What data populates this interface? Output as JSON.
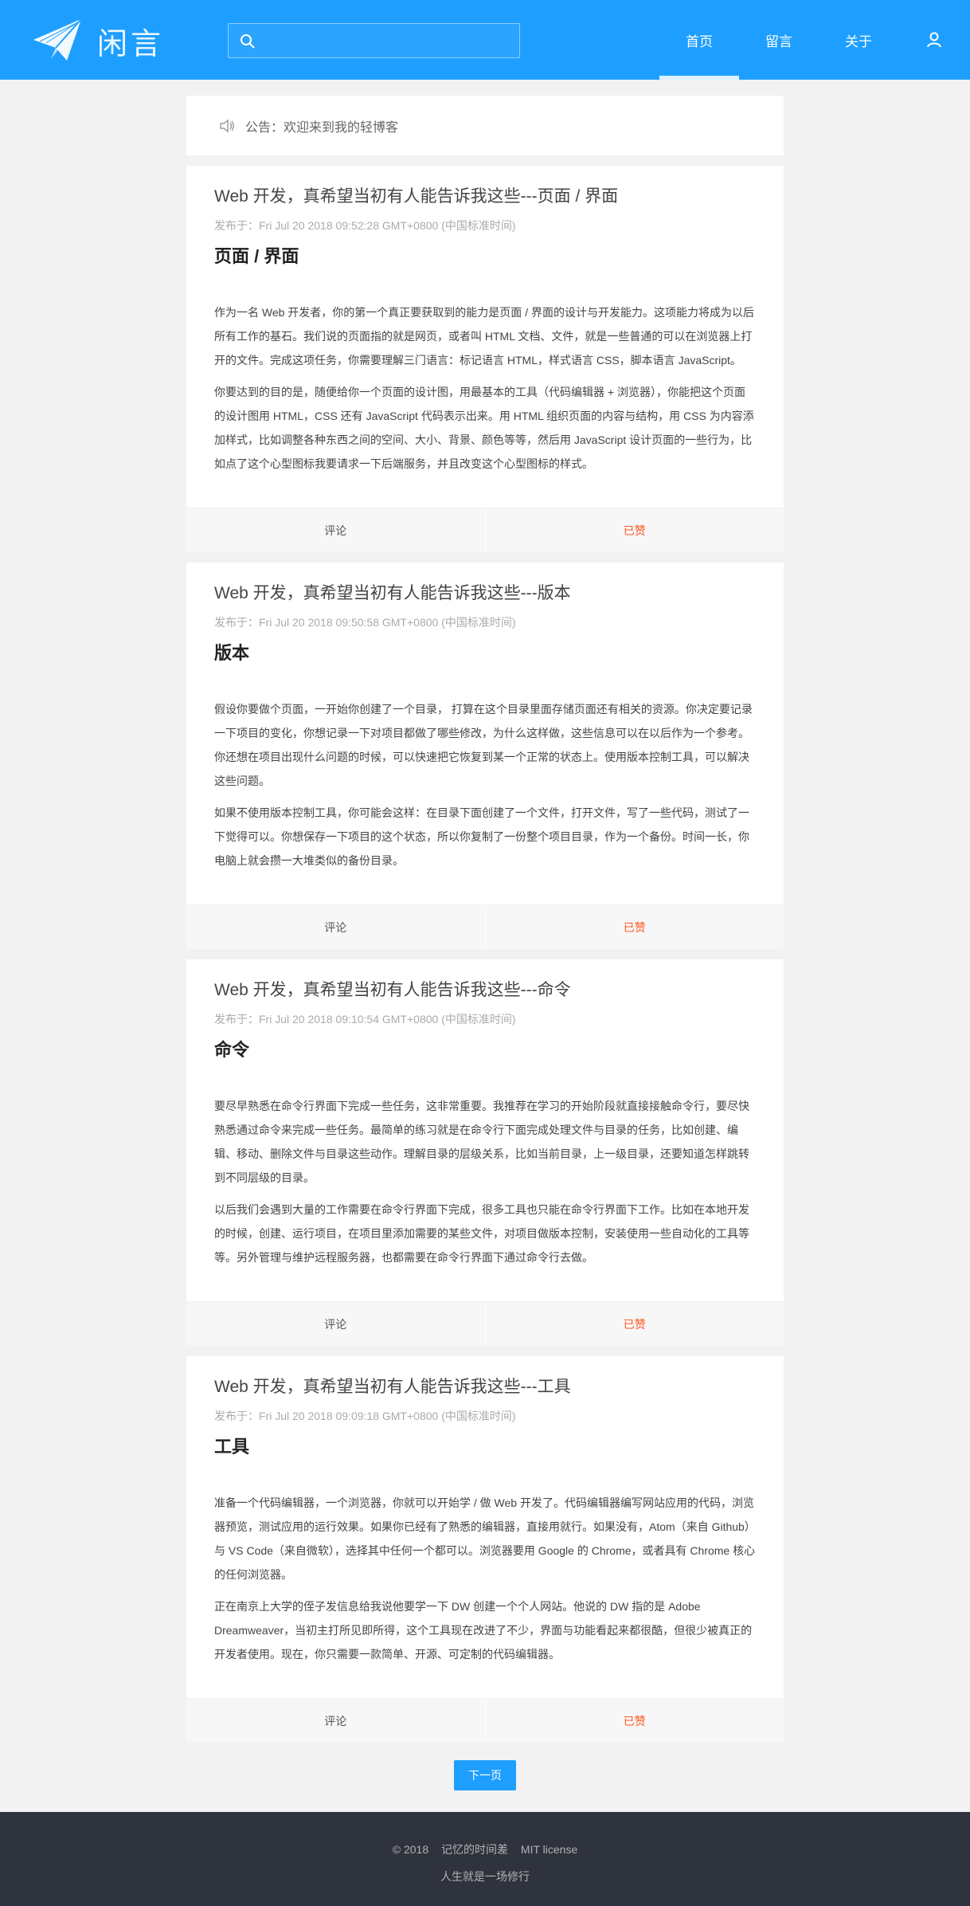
{
  "header": {
    "logo_text": "闲言",
    "search": {
      "placeholder": "",
      "value": ""
    },
    "nav": [
      {
        "label": "首页",
        "active": true
      },
      {
        "label": "留言",
        "active": false
      },
      {
        "label": "关于",
        "active": false
      }
    ]
  },
  "notice": {
    "text": "公告：欢迎来到我的轻博客"
  },
  "posts": [
    {
      "title": "Web 开发，真希望当初有人能告诉我这些---页面 / 界面",
      "meta": "发布于：Fri Jul 20 2018 09:52:28 GMT+0800 (中国标准时间)",
      "heading": "页面 / 界面",
      "paragraphs": [
        "作为一名 Web 开发者，你的第一个真正要获取到的能力是页面 / 界面的设计与开发能力。这项能力将成为以后所有工作的基石。我们说的页面指的就是网页，或者叫 HTML 文档、文件，就是一些普通的可以在浏览器上打开的文件。完成这项任务，你需要理解三门语言：标记语言 HTML，样式语言 CSS，脚本语言 JavaScript。",
        "你要达到的目的是，随便给你一个页面的设计图，用最基本的工具（代码编辑器 + 浏览器），你能把这个页面的设计图用 HTML，CSS 还有 JavaScript 代码表示出来。用 HTML 组织页面的内容与结构，用 CSS 为内容添加样式，比如调整各种东西之间的空间、大小、背景、颜色等等，然后用 JavaScript 设计页面的一些行为，比如点了这个心型图标我要请求一下后端服务，并且改变这个心型图标的样式。"
      ],
      "comment_label": "评论",
      "like_label": "已赞"
    },
    {
      "title": "Web 开发，真希望当初有人能告诉我这些---版本",
      "meta": "发布于：Fri Jul 20 2018 09:50:58 GMT+0800 (中国标准时间)",
      "heading": "版本",
      "paragraphs": [
        "假设你要做个页面，一开始你创建了一个目录， 打算在这个目录里面存储页面还有相关的资源。你决定要记录一下项目的变化，你想记录一下对项目都做了哪些修改，为什么这样做，这些信息可以在以后作为一个参考。你还想在项目出现什么问题的时候，可以快速把它恢复到某一个正常的状态上。使用版本控制工具，可以解决这些问题。",
        "如果不使用版本控制工具，你可能会这样：在目录下面创建了一个文件，打开文件，写了一些代码，测试了一下觉得可以。你想保存一下项目的这个状态，所以你复制了一份整个项目目录，作为一个备份。时间一长，你电脑上就会攒一大堆类似的备份目录。"
      ],
      "comment_label": "评论",
      "like_label": "已赞"
    },
    {
      "title": "Web 开发，真希望当初有人能告诉我这些---命令",
      "meta": "发布于：Fri Jul 20 2018 09:10:54 GMT+0800 (中国标准时间)",
      "heading": "命令",
      "paragraphs": [
        "要尽早熟悉在命令行界面下完成一些任务，这非常重要。我推荐在学习的开始阶段就直接接触命令行，要尽快熟悉通过命令来完成一些任务。最简单的练习就是在命令行下面完成处理文件与目录的任务，比如创建、编辑、移动、删除文件与目录这些动作。理解目录的层级关系，比如当前目录，上一级目录，还要知道怎样跳转到不同层级的目录。",
        "以后我们会遇到大量的工作需要在命令行界面下完成，很多工具也只能在命令行界面下工作。比如在本地开发的时候，创建、运行项目，在项目里添加需要的某些文件，对项目做版本控制，安装使用一些自动化的工具等等。另外管理与维护远程服务器，也都需要在命令行界面下通过命令行去做。"
      ],
      "comment_label": "评论",
      "like_label": "已赞"
    },
    {
      "title": "Web 开发，真希望当初有人能告诉我这些---工具",
      "meta": "发布于：Fri Jul 20 2018 09:09:18 GMT+0800 (中国标准时间)",
      "heading": "工具",
      "paragraphs": [
        "准备一个代码编辑器，一个浏览器，你就可以开始学 / 做 Web 开发了。代码编辑器编写网站应用的代码，浏览器预览，测试应用的运行效果。如果你已经有了熟悉的编辑器，直接用就行。如果没有，Atom（来自 Github）与 VS Code（来自微软），选择其中任何一个都可以。浏览器要用 Google 的 Chrome，或者具有 Chrome 核心的任何浏览器。",
        "正在南京上大学的侄子发信息给我说他要学一下 DW 创建一个个人网站。他说的 DW 指的是 Adobe Dreamweaver，当初主打所见即所得，这个工具现在改进了不少，界面与功能看起来都很酷，但很少被真正的开发者使用。现在，你只需要一款简单、开源、可定制的代码编辑器。"
      ],
      "comment_label": "评论",
      "like_label": "已赞"
    }
  ],
  "pager": {
    "next_label": "下一页"
  },
  "footer": {
    "year": "© 2018",
    "site": "记忆的时间差",
    "license": "MIT license",
    "motto": "人生就是一场修行"
  },
  "colors": {
    "brand": "#1e9fff",
    "liked": "#ff5722",
    "footer_bg": "#2f333d"
  },
  "icons": {
    "logo": "paper-plane-icon",
    "search": "search-icon",
    "notice": "speaker-icon",
    "user": "user-icon"
  }
}
